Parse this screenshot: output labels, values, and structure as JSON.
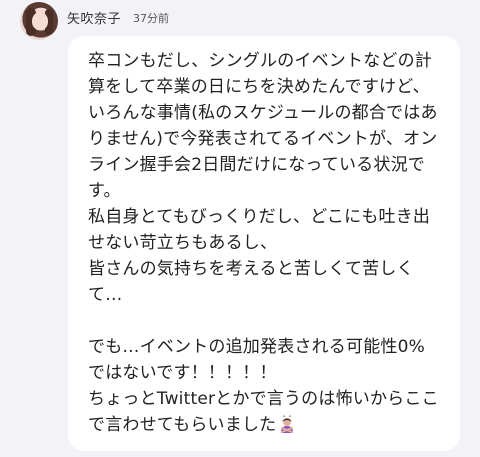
{
  "post": {
    "author": "矢吹奈子",
    "time": "37分前",
    "body": {
      "lines": [
        "卒コンもだし、シングルのイベントなどの計",
        "算をして卒業の日にちを決めたんですけど、",
        "いろんな事情(私のスケジュールの都合ではあ",
        "りません)で今発表されてるイベントが、オン",
        "ライン握手会2日間だけになっている状況で",
        "す。",
        "私自身とてもびっくりだし、どこにも吐き出",
        "せない苛立ちもあるし、",
        "皆さんの気持ちを考えると苦しくて苦しく",
        "て…",
        "",
        "でも…イベントの追加発表される可能性0%",
        "ではないです！！！！！",
        "ちょっとTwitterとかで言うのは怖いからここ",
        "で言わせてもらいました"
      ],
      "emoji_icon": "person-gesturing-no-emoji"
    }
  }
}
